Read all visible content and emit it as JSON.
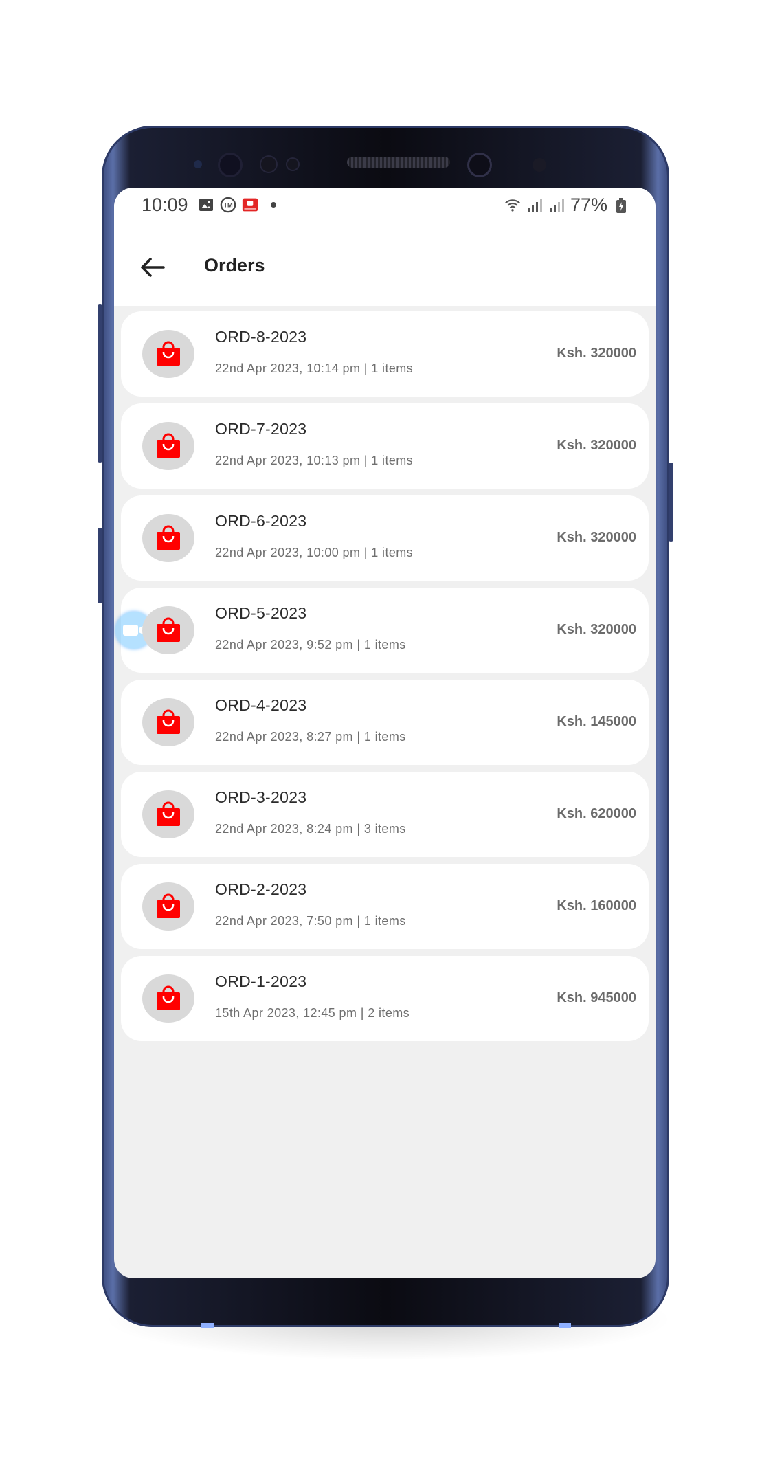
{
  "status_bar": {
    "time": "10:09",
    "battery": "77%"
  },
  "app_bar": {
    "title": "Orders"
  },
  "orders": [
    {
      "id": "ORD-8-2023",
      "meta": "22nd Apr 2023, 10:14 pm | 1 items",
      "amount": "Ksh. 320000"
    },
    {
      "id": "ORD-7-2023",
      "meta": "22nd Apr 2023, 10:13 pm | 1 items",
      "amount": "Ksh. 320000"
    },
    {
      "id": "ORD-6-2023",
      "meta": "22nd Apr 2023, 10:00 pm | 1 items",
      "amount": "Ksh. 320000"
    },
    {
      "id": "ORD-5-2023",
      "meta": "22nd Apr 2023, 9:52 pm | 1 items",
      "amount": "Ksh. 320000"
    },
    {
      "id": "ORD-4-2023",
      "meta": "22nd Apr 2023, 8:27 pm | 1 items",
      "amount": "Ksh. 145000"
    },
    {
      "id": "ORD-3-2023",
      "meta": "22nd Apr 2023, 8:24 pm | 3 items",
      "amount": "Ksh. 620000"
    },
    {
      "id": "ORD-2-2023",
      "meta": "22nd Apr 2023, 7:50 pm | 1 items",
      "amount": "Ksh. 160000"
    },
    {
      "id": "ORD-1-2023",
      "meta": "15th Apr 2023, 12:45 pm | 2 items",
      "amount": "Ksh. 945000"
    }
  ],
  "icons": {
    "order": "shopping-bag-icon",
    "back": "arrow-left-icon"
  },
  "colors": {
    "accent": "#ff0000",
    "avatar_bg": "#d9d9d9",
    "list_bg": "#f0f0f0"
  }
}
